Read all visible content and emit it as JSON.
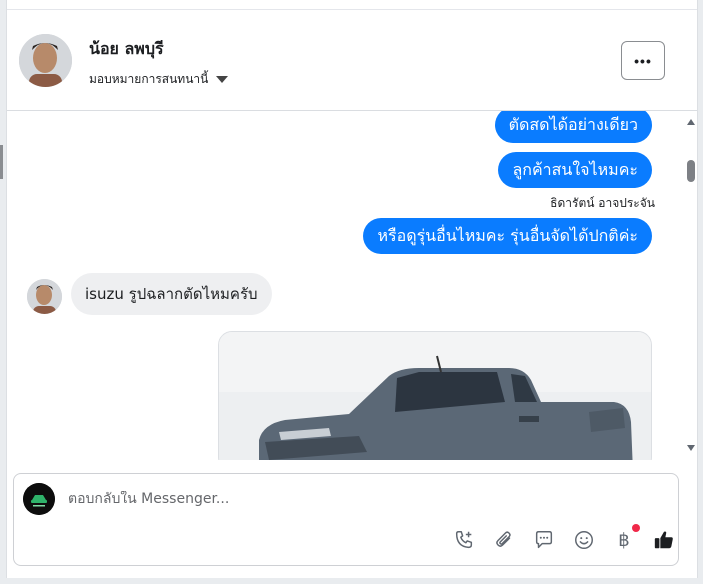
{
  "contact": {
    "name": "น้อย ลพบุรี",
    "assign_label": "มอบหมายการสนทนานี้"
  },
  "header": {
    "more_label": "•••"
  },
  "messages": {
    "outgoing": [
      "ตัดสดได้อย่างเดียว",
      "ลูกค้าสนใจไหมคะ",
      "หรือดูรุ่นอื่นไหมคะ รุ่นอื่นจัดได้ปกติค่ะ"
    ],
    "sender_label": "ธิดารัตน์ อาจประจัน",
    "incoming": "isuzu รูปฉลากตัดไหมครับ"
  },
  "composer": {
    "placeholder": "ตอบกลับใน Messenger...",
    "currency_symbol": "฿"
  },
  "icons": [
    "more-icon",
    "caret-down-icon",
    "call-add-icon",
    "paperclip-icon",
    "chat-bubble-icon",
    "emoji-icon",
    "baht-icon",
    "thumbs-up-icon"
  ],
  "colors": {
    "outgoing_bubble": "#0a7cff",
    "incoming_bubble": "#eeeff1",
    "thumbs_up": "#1c1e21",
    "notification_dot": "#f02849"
  }
}
